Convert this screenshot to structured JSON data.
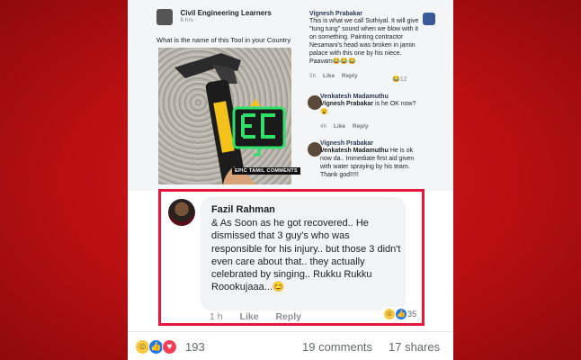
{
  "original_post": {
    "page_name": "Civil Engineering Learners",
    "time": "6 hrs ·",
    "question": "What is the name of this Tool in your Country",
    "watermark": "EPIC TAMIL COMMENTS"
  },
  "thread_replies": [
    {
      "name": "Vignesh Prabakar",
      "text": "This is what we call Suthiyal. It will give \"tung tung\" sound when we blow with it on something. Painting contractor Nesamani's head was broken in jamin palace with this one by his niece. Paavam😂😂😂",
      "time": "5h",
      "like": "Like",
      "reply": "Reply",
      "reactions": "12"
    },
    {
      "name": "Venkatesh Madamuthu",
      "mention": "Vignesh Prabakar",
      "text": "is he OK now? 😮",
      "time": "4h",
      "like": "Like",
      "reply": "Reply"
    },
    {
      "name": "Vignesh Prabakar",
      "mention": "Venkatesh Madamuthu",
      "text": "He is ok now da.. Immediate first aid given with water spraying by his team. Thank god!!!!!",
      "time": "4h",
      "like": "Like",
      "reply": "Reply"
    }
  ],
  "highlighted_comment": {
    "name": "Fazil Rahman",
    "text": "& As Soon as he got recovered.. He dismissed that 3 guy's who was responsible for his injury.. but those 3 didn't even care about that.. they actually celebrated by singing.. Rukku Rukku Roookujaaa...😊",
    "time": "1 h",
    "like": "Like",
    "reply": "Reply",
    "reaction_count": "35",
    "highlight_color": "#e6173d"
  },
  "footer": {
    "reaction_count": "193",
    "comments": "19 comments",
    "shares": "17 shares"
  },
  "icons": [
    "haha-emoji-icon",
    "like-emoji-icon",
    "love-emoji-icon",
    "hammer-image",
    "epic-tamil-logo-icon"
  ],
  "colors": {
    "background": "#c4121a",
    "highlight": "#e6173d",
    "like_blue": "#1877f2",
    "name_blue": "#2b3a59"
  }
}
